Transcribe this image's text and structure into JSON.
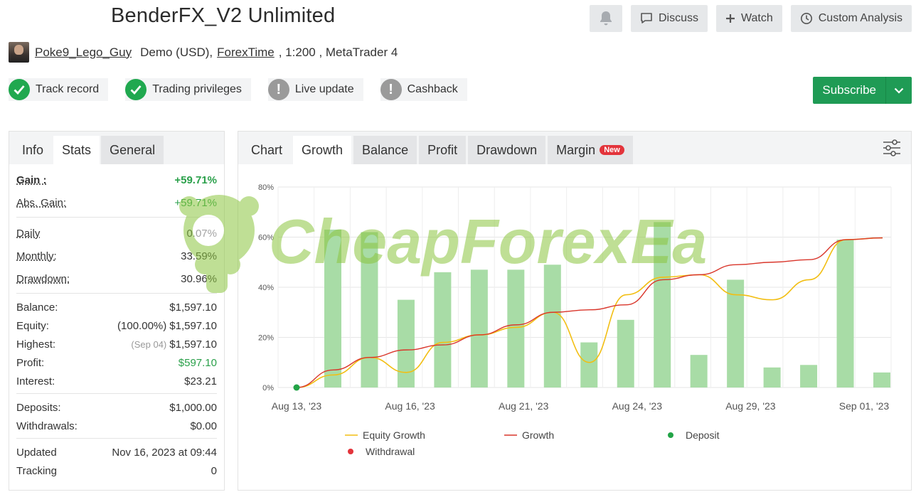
{
  "header": {
    "title": "BenderFX_V2 Unlimited",
    "user": "Poke9_Lego_Guy",
    "account_type": "Demo (USD),",
    "broker": "ForexTime",
    "leverage_platform": ", 1:200 , MetaTrader 4"
  },
  "actions": {
    "discuss": "Discuss",
    "watch": "Watch",
    "custom_analysis": "Custom Analysis",
    "subscribe": "Subscribe"
  },
  "badges": [
    {
      "label": "Track record",
      "status": "ok"
    },
    {
      "label": "Trading privileges",
      "status": "ok"
    },
    {
      "label": "Live update",
      "status": "warning"
    },
    {
      "label": "Cashback",
      "status": "warning"
    }
  ],
  "left_tabs": [
    "Info",
    "Stats",
    "General"
  ],
  "stats": {
    "gain_label": "Gain :",
    "gain": "+59.71%",
    "abs_gain_label": "Abs. Gain:",
    "abs_gain": "+59.71%",
    "daily_label": "Daily",
    "daily": "0.07%",
    "monthly_label": "Monthly:",
    "monthly": "33.59%",
    "drawdown_label": "Drawdown:",
    "drawdown": "30.96%",
    "balance_label": "Balance:",
    "balance": "$1,597.10",
    "equity_label": "Equity:",
    "equity_pct": "(100.00%)",
    "equity": "$1,597.10",
    "highest_label": "Highest:",
    "highest_date": "(Sep 04)",
    "highest": "$1,597.10",
    "profit_label": "Profit:",
    "profit": "$597.10",
    "interest_label": "Interest:",
    "interest": "$23.21",
    "deposits_label": "Deposits:",
    "deposits": "$1,000.00",
    "withdrawals_label": "Withdrawals:",
    "withdrawals": "$0.00",
    "updated_label": "Updated",
    "updated": "Nov 16, 2023 at 09:44",
    "tracking_label": "Tracking",
    "tracking": "0"
  },
  "chart_tabs": [
    "Chart",
    "Growth",
    "Balance",
    "Profit",
    "Drawdown",
    "Margin"
  ],
  "new_badge": "New",
  "watermark": "CheapForexEa",
  "colors": {
    "green_button": "#1f9b55",
    "check_green": "#20a84f",
    "bar": "#a8dca6",
    "equity_line": "#f2be12",
    "growth_line": "#d9362b",
    "deposit": "#22a447",
    "withdrawal": "#e3343b"
  },
  "chart_data": {
    "type": "bar",
    "title": "",
    "xlabel": "",
    "ylabel": "",
    "ylim": [
      0,
      80
    ],
    "y_ticks": [
      "0%",
      "20%",
      "40%",
      "60%",
      "80%"
    ],
    "x_tick_labels": [
      "Aug 13, '23",
      "Aug 16, '23",
      "Aug 21, '23",
      "Aug 24, '23",
      "Aug 29, '23",
      "Sep 01, '23"
    ],
    "grid": true,
    "legend_position": "bottom",
    "legend": [
      "Equity Growth",
      "Growth",
      "Deposit",
      "Withdrawal"
    ],
    "bars": [
      63,
      62,
      35,
      46,
      47,
      47,
      49,
      18,
      27,
      66,
      13,
      43,
      8,
      9,
      59,
      6
    ],
    "growth": [
      0,
      7,
      12,
      15,
      17,
      21,
      25,
      30,
      31,
      33,
      43,
      45,
      49,
      50,
      51,
      59,
      59.7
    ],
    "equity_growth": [
      0,
      5,
      12,
      6,
      18,
      21,
      24,
      30,
      10,
      37,
      44,
      45,
      37,
      35,
      43,
      59,
      59.7
    ],
    "deposits": [
      0
    ]
  }
}
